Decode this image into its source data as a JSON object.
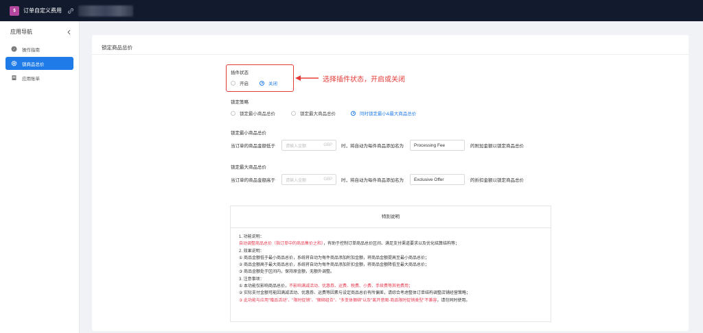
{
  "topbar": {
    "logo_text": "$",
    "app_title": "订单自定义费用"
  },
  "sidebar": {
    "title": "应用导航",
    "items": [
      {
        "label": "操作指南",
        "icon": "guide-icon"
      },
      {
        "label": "锁商品总价",
        "icon": "gear-icon",
        "active": true
      },
      {
        "label": "应用账单",
        "icon": "bill-icon"
      }
    ]
  },
  "card": {
    "title": "锁定商品总价"
  },
  "plugin_status": {
    "label": "插件状态",
    "options": [
      {
        "label": "开启",
        "selected": false
      },
      {
        "label": "关闭",
        "selected": true
      }
    ]
  },
  "annotation": {
    "text": "选择插件状态，开启或关闭",
    "color": "#e53935"
  },
  "strategy": {
    "label": "锁定策略",
    "options": [
      {
        "label": "锁定最小商品总价",
        "selected": false
      },
      {
        "label": "锁定最大商品总价",
        "selected": false
      },
      {
        "label": "同时锁定最小&最大商品总价",
        "selected": true
      }
    ]
  },
  "min_section": {
    "label": "锁定最小商品总价",
    "prefix": "当订单的商品金额低于",
    "amount_placeholder": "请输入金额",
    "currency": "GBP",
    "middle": "时，将自动为每件商品添加名为",
    "fee_name": "Processing Fee",
    "suffix": "的附加金额以锁定商品总价"
  },
  "max_section": {
    "label": "锁定最大商品总价",
    "prefix": "当订单的商品金额高于",
    "amount_placeholder": "请输入金额",
    "currency": "GBP",
    "middle": "时，将自动为每件商品添加名为",
    "fee_name": "Exclusive Offer",
    "suffix": "的折扣金额以锁定商品总价"
  },
  "notes": {
    "title": "特别说明",
    "line1": "1. 功能说明：",
    "line2_red": "自动调整商品总价（指订单中的商品售价之和）",
    "line2_rest": "，有助于控制订单商品总价区间、满足支付渠道要求以及优化结算结构等；",
    "line3": "2. 效果说明：",
    "line4": "① 商品金额低于最小商品总价，系统将自动为每件商品添加附加金额，将商品金额提高至最小商品总价；",
    "line5": "② 商品金额高于最大商品总价，系统将自动为每件商品添加折扣金额，将商品金额降低至最大商品总价；",
    "line6": "③ 商品金额处于区间内，保持原金额，无额外调整。",
    "line7": "3. 注意事项：",
    "line8_a": "① 本功能仅影响商品总价，",
    "line8_red": "不影响满减活动、优惠券、运费、税费、小费、手续费等其他费用；",
    "line9": "② 实际支付金额可能因满减活动、优惠券、运费等因素与设定商品总价有所偏差，请综合考虑整体订单结构调整店铺经营策略；",
    "line10_red": "③ 此功能与应用\"赠品活动\"、\"限时促销\"、\"捆绑组合\"、\"多变体捆绑\"以及\"离开意图-商品限时促销类型\"不兼容",
    "line10_rest": "，请勿同时使用。"
  }
}
